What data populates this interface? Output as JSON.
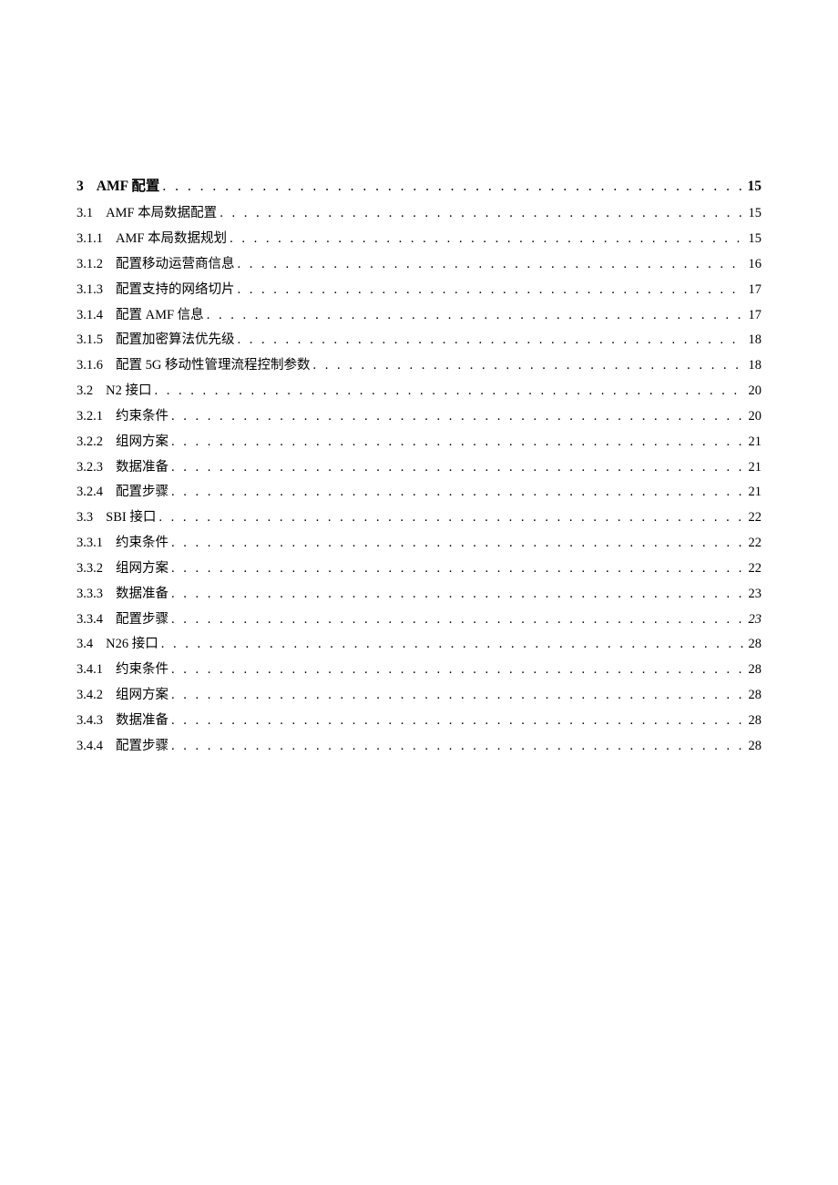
{
  "toc": [
    {
      "number": "3",
      "title": "AMF 配置",
      "page": "15",
      "level": 1,
      "italic": false
    },
    {
      "number": "3.1",
      "title": "AMF 本局数据配置",
      "page": "15",
      "level": 2,
      "italic": false
    },
    {
      "number": "3.1.1",
      "title": "AMF 本局数据规划",
      "page": "15",
      "level": 3,
      "italic": false
    },
    {
      "number": "3.1.2",
      "title": "配置移动运营商信息",
      "page": "16",
      "level": 3,
      "italic": false
    },
    {
      "number": "3.1.3",
      "title": "配置支持的网络切片",
      "page": "17",
      "level": 3,
      "italic": false
    },
    {
      "number": "3.1.4",
      "title": "配置 AMF 信息",
      "page": "17",
      "level": 3,
      "italic": false
    },
    {
      "number": "3.1.5",
      "title": "配置加密算法优先级",
      "page": "18",
      "level": 3,
      "italic": false
    },
    {
      "number": "3.1.6",
      "title": "配置 5G 移动性管理流程控制参数",
      "page": "18",
      "level": 3,
      "italic": false
    },
    {
      "number": "3.2",
      "title": "N2 接口",
      "page": "20",
      "level": 2,
      "italic": false
    },
    {
      "number": "3.2.1",
      "title": "约束条件",
      "page": "20",
      "level": 3,
      "italic": false
    },
    {
      "number": "3.2.2",
      "title": "组网方案",
      "page": "21",
      "level": 3,
      "italic": false
    },
    {
      "number": "3.2.3",
      "title": "数据准备",
      "page": "21",
      "level": 3,
      "italic": false
    },
    {
      "number": "3.2.4",
      "title": "配置步骤",
      "page": "21",
      "level": 3,
      "italic": false
    },
    {
      "number": "3.3",
      "title": "SBI 接口",
      "page": "22",
      "level": 2,
      "italic": false
    },
    {
      "number": "3.3.1",
      "title": "约束条件",
      "page": "22",
      "level": 3,
      "italic": false
    },
    {
      "number": "3.3.2",
      "title": "组网方案",
      "page": "22",
      "level": 3,
      "italic": false
    },
    {
      "number": "3.3.3",
      "title": "数据准备",
      "page": "23",
      "level": 3,
      "italic": false
    },
    {
      "number": "3.3.4",
      "title": "配置步骤",
      "page": "23",
      "level": 3,
      "italic": true
    },
    {
      "number": "3.4",
      "title": "N26 接口",
      "page": "28",
      "level": 2,
      "italic": false
    },
    {
      "number": "3.4.1",
      "title": "约束条件",
      "page": "28",
      "level": 3,
      "italic": false
    },
    {
      "number": "3.4.2",
      "title": "组网方案",
      "page": "28",
      "level": 3,
      "italic": false
    },
    {
      "number": "3.4.3",
      "title": "数据准备",
      "page": "28",
      "level": 3,
      "italic": false
    },
    {
      "number": "3.4.4",
      "title": "配置步骤",
      "page": "28",
      "level": 3,
      "italic": false
    }
  ],
  "dots": ". . . . . . . . . . . . . . . . . . . . . . . . . . . . . . . . . . . . . . . . . . . . . . . . . . . . . . . . . . . . . . . . . . . . . . . . . . . . . . . . . . . . . . . . . . . . . . . . . . . . . . . . . . . . . . . . . . . . . . . . . . . . . . . . . . . . . . . . . . . . . . . ."
}
